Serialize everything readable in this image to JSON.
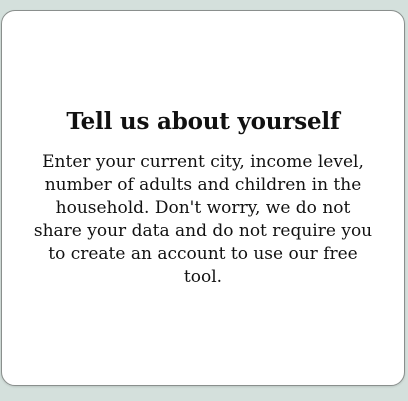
{
  "card": {
    "title": "Tell us about yourself",
    "body": "Enter your current city, income level, number of adults and children in the household. Don't worry, we do not share your data and do not require you to create an account to use our free tool."
  },
  "colors": {
    "page_background": "#d4e0dc",
    "card_background": "#ffffff",
    "card_border": "#8a8f8d",
    "text": "#111111"
  }
}
